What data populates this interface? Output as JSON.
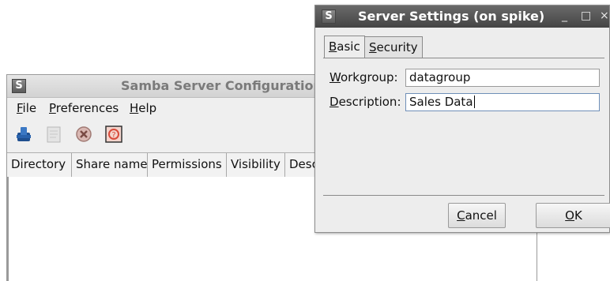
{
  "main_window": {
    "title": "Samba Server Configuration",
    "icon_letter": "S",
    "menu": [
      {
        "mnemonic": "F",
        "rest": "ile"
      },
      {
        "mnemonic": "P",
        "rest": "references"
      },
      {
        "mnemonic": "H",
        "rest": "elp"
      }
    ],
    "toolbar_icons": [
      "add-share-icon",
      "properties-icon",
      "delete-icon",
      "help-icon"
    ],
    "table": {
      "columns": [
        "Directory",
        "Share name",
        "Permissions",
        "Visibility",
        "Desc"
      ],
      "rows": []
    }
  },
  "dialog": {
    "title": "Server Settings (on spike)",
    "icon_letter": "S",
    "wm_buttons": {
      "minimize": "_",
      "maximize": "□",
      "close": "×"
    },
    "tabs": [
      {
        "mnemonic": "B",
        "rest": "asic",
        "active": true
      },
      {
        "mnemonic": "S",
        "rest": "ecurity",
        "active": false
      }
    ],
    "fields": {
      "workgroup": {
        "mnemonic": "W",
        "rest": "orkgroup:",
        "value": "datagroup"
      },
      "description": {
        "mnemonic": "D",
        "rest": "escription:",
        "value": "Sales Data"
      }
    },
    "buttons": {
      "cancel": {
        "mnemonic": "C",
        "rest": "ancel"
      },
      "ok": {
        "mnemonic": "O",
        "rest": "K"
      }
    }
  }
}
